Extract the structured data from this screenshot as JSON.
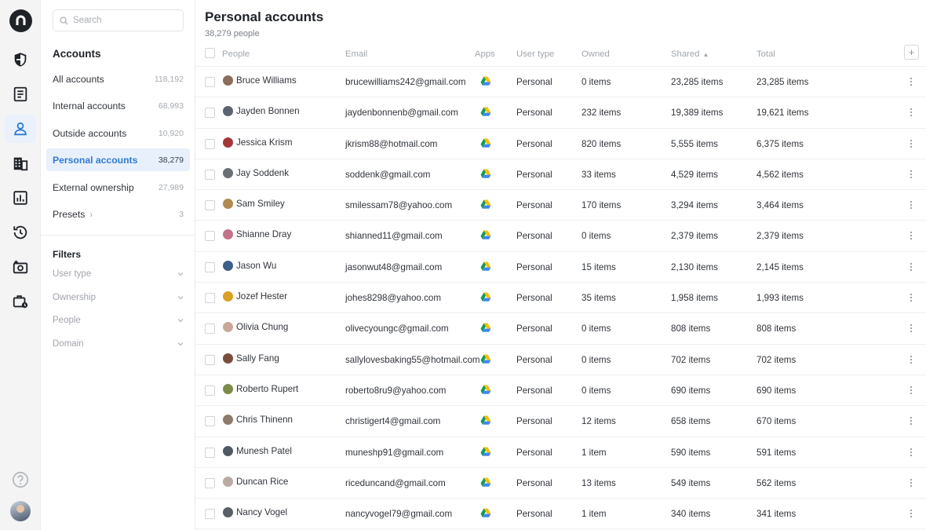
{
  "rail": {
    "items": [
      {
        "name": "security-shield"
      },
      {
        "name": "document-list"
      },
      {
        "name": "user-person"
      },
      {
        "name": "office-building"
      },
      {
        "name": "reports-chart"
      },
      {
        "name": "history-clock"
      },
      {
        "name": "camera-snapshot"
      },
      {
        "name": "briefcase-clock"
      }
    ],
    "active_item": "user-person"
  },
  "sidebar": {
    "search_placeholder": "Search",
    "accounts_heading": "Accounts",
    "items": [
      {
        "label": "All accounts",
        "count": "118,192"
      },
      {
        "label": "Internal accounts",
        "count": "68,993"
      },
      {
        "label": "Outside accounts",
        "count": "10,920"
      },
      {
        "label": "Personal accounts",
        "count": "38,279"
      },
      {
        "label": "External ownership",
        "count": "27,989"
      },
      {
        "label": "Presets",
        "count": "3"
      }
    ],
    "filters_heading": "Filters",
    "filters": [
      "User type",
      "Ownership",
      "People",
      "Domain"
    ]
  },
  "main": {
    "title": "Personal accounts",
    "subtitle": "38,279 people",
    "columns": {
      "people": "People",
      "email": "Email",
      "apps": "Apps",
      "user_type": "User type",
      "owned": "Owned",
      "shared": "Shared",
      "total": "Total",
      "add": "+"
    },
    "sort_column": "Shared",
    "sort_direction": "ascending",
    "rows": [
      {
        "name": "Bruce Williams",
        "email": "brucewilliams242@gmail.com",
        "type": "Personal",
        "owned": "0 items",
        "shared": "23,285 items",
        "total": "23,285 items",
        "avatar": "#8a6e5a"
      },
      {
        "name": "Jayden Bonnen",
        "email": "jaydenbonnenb@gmail.com",
        "type": "Personal",
        "owned": "232 items",
        "shared": "19,389 items",
        "total": "19,621 items",
        "avatar": "#5b6470"
      },
      {
        "name": "Jessica Krism",
        "email": "jkrism88@hotmail.com",
        "type": "Personal",
        "owned": "820 items",
        "shared": "5,555 items",
        "total": "6,375 items",
        "avatar": "#a4373a"
      },
      {
        "name": "Jay Soddenk",
        "email": "soddenk@gmail.com",
        "type": "Personal",
        "owned": "33 items",
        "shared": "4,529 items",
        "total": "4,562 items",
        "avatar": "#6b6f76"
      },
      {
        "name": "Sam Smiley",
        "email": "smilessam78@yahoo.com",
        "type": "Personal",
        "owned": "170 items",
        "shared": "3,294 items",
        "total": "3,464 items",
        "avatar": "#b08a4e"
      },
      {
        "name": "Shianne Dray",
        "email": "shianned11@gmail.com",
        "type": "Personal",
        "owned": "0 items",
        "shared": "2,379 items",
        "total": "2,379 items",
        "avatar": "#c2728a"
      },
      {
        "name": "Jason Wu",
        "email": "jasonwut48@gmail.com",
        "type": "Personal",
        "owned": "15 items",
        "shared": "2,130 items",
        "total": "2,145 items",
        "avatar": "#3e5f8a"
      },
      {
        "name": "Jozef Hester",
        "email": "johes8298@yahoo.com",
        "type": "Personal",
        "owned": "35 items",
        "shared": "1,958 items",
        "total": "1,993 items",
        "avatar": "#d9a021"
      },
      {
        "name": "Olivia Chung",
        "email": "olivecyoungc@gmail.com",
        "type": "Personal",
        "owned": "0 items",
        "shared": "808 items",
        "total": "808 items",
        "avatar": "#c9a89a"
      },
      {
        "name": "Sally Fang",
        "email": "sallylovesbaking55@hotmail.com",
        "type": "Personal",
        "owned": "0 items",
        "shared": "702 items",
        "total": "702 items",
        "avatar": "#7a4e3e"
      },
      {
        "name": "Roberto Rupert",
        "email": "roberto8ru9@yahoo.com",
        "type": "Personal",
        "owned": "0 items",
        "shared": "690 items",
        "total": "690 items",
        "avatar": "#7c8a4a"
      },
      {
        "name": "Chris Thinenn",
        "email": "christigert4@gmail.com",
        "type": "Personal",
        "owned": "12 items",
        "shared": "658 items",
        "total": "670 items",
        "avatar": "#8d7a6a"
      },
      {
        "name": "Munesh Patel",
        "email": "muneshp91@gmail.com",
        "type": "Personal",
        "owned": "1 item",
        "shared": "590 items",
        "total": "591 items",
        "avatar": "#4f5963"
      },
      {
        "name": "Duncan Rice",
        "email": "riceduncand@gmail.com",
        "type": "Personal",
        "owned": "13 items",
        "shared": "549 items",
        "total": "562 items",
        "avatar": "#b9aaa3"
      },
      {
        "name": "Nancy Vogel",
        "email": "nancyvogel79@gmail.com",
        "type": "Personal",
        "owned": "1 item",
        "shared": "340 items",
        "total": "341 items",
        "avatar": "#5a5f66"
      }
    ],
    "app_icon": "google-drive-icon",
    "colors": {
      "accent": "#2f7bd4",
      "active_bg": "#e8f0fb"
    }
  }
}
